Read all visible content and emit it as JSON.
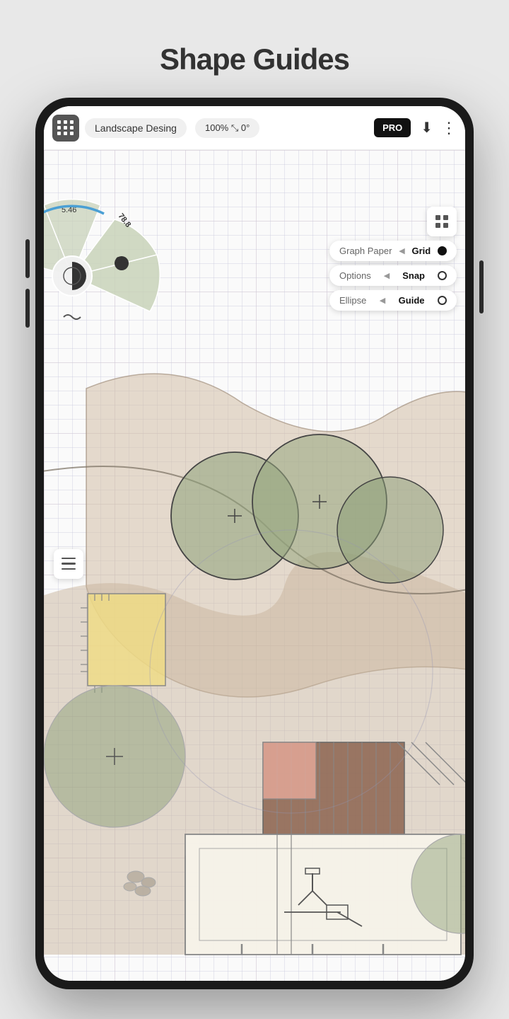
{
  "page": {
    "title": "Shape Guides"
  },
  "topbar": {
    "grid_btn_label": "grid",
    "project_name": "Landscape Desing",
    "zoom_label": "100%  ⤡ 0°",
    "pro_label": "PRO",
    "download_label": "⬇",
    "more_label": "⋮"
  },
  "right_panel": {
    "grid_view_icon": "grid-view",
    "row1": {
      "left": "Graph Paper",
      "chevron": "◀",
      "right": "Grid",
      "indicator": "filled"
    },
    "row2": {
      "left": "Options",
      "chevron": "◀",
      "right": "Snap",
      "indicator": "empty"
    },
    "row3": {
      "left": "Ellipse",
      "chevron": "◀",
      "right": "Guide",
      "indicator": "empty"
    }
  },
  "left_menu": {
    "label": "hamburger-menu"
  }
}
